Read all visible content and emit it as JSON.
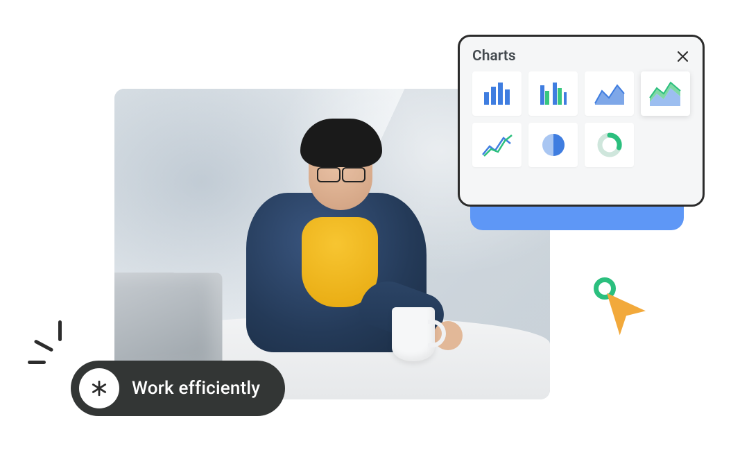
{
  "pill": {
    "label": "Work efficiently",
    "icon": "asterisk-icon"
  },
  "charts_panel": {
    "title": "Charts",
    "close_icon": "close-icon",
    "options": [
      {
        "name": "bar-chart-icon",
        "selected": false
      },
      {
        "name": "grouped-bar-chart-icon",
        "selected": false
      },
      {
        "name": "area-chart-icon",
        "selected": false
      },
      {
        "name": "stacked-area-chart-icon",
        "selected": true
      },
      {
        "name": "line-chart-icon",
        "selected": false
      },
      {
        "name": "pie-chart-icon",
        "selected": false
      },
      {
        "name": "donut-chart-icon",
        "selected": false
      }
    ]
  },
  "decorations": {
    "cursor_icon": "cursor-icon",
    "ring_icon": "ring-icon",
    "spark_icon": "spark-lines-icon"
  },
  "colors": {
    "pill_bg": "#333635",
    "panel_accent": "#5e97f6",
    "green": "#2bbf7e",
    "orange": "#f2a93b",
    "blue": "#3f7de0"
  }
}
